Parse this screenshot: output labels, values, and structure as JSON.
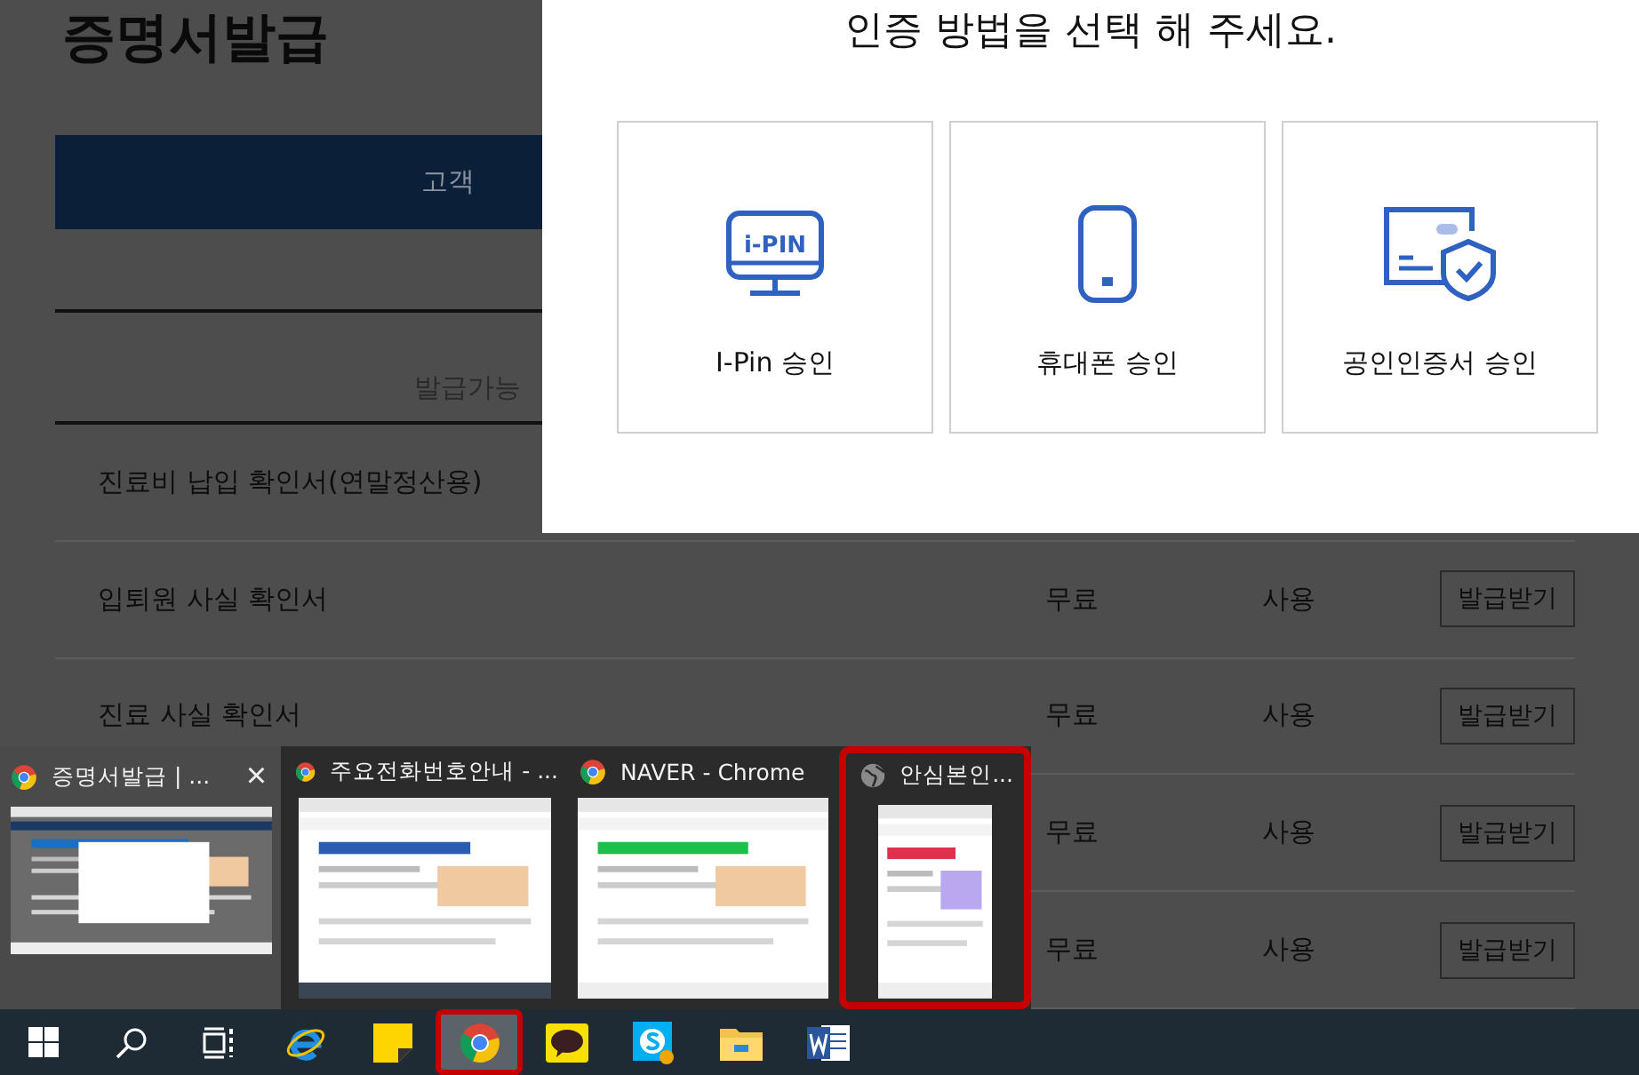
{
  "page": {
    "heading": "증명서발급",
    "tab": "고객",
    "column_header": "발급가능",
    "rows": [
      {
        "name": "진료비 납입 확인서(연말정산용)"
      },
      {
        "name": "입퇴원 사실 확인서",
        "fee": "무료",
        "use": "사용",
        "button": "발급받기"
      },
      {
        "name": "진료 사실 확인서",
        "fee": "무료",
        "use": "사용",
        "button": "발급받기"
      },
      {
        "fee": "무료",
        "use": "사용",
        "button": "발급받기"
      },
      {
        "fee": "무료",
        "use": "사용",
        "button": "발급받기"
      }
    ]
  },
  "modal": {
    "title": "인증 방법을 선택 해 주세요.",
    "options": [
      {
        "kind": "ipin",
        "icon_text": "i-PIN",
        "label": "I-Pin 승인"
      },
      {
        "kind": "phone",
        "label": "휴대폰 승인"
      },
      {
        "kind": "certificate",
        "label": "공인인증서 승인"
      }
    ]
  },
  "thumbnails": [
    {
      "title": "증명서발급 | ...",
      "hovered": true,
      "highlighted": false,
      "kind": "chrome",
      "close": "×"
    },
    {
      "title": "주요전화번호안내 - ...",
      "hovered": false,
      "highlighted": false,
      "kind": "chrome"
    },
    {
      "title": "NAVER - Chrome",
      "hovered": false,
      "highlighted": false,
      "kind": "chrome"
    },
    {
      "title": "안심본인...",
      "hovered": false,
      "highlighted": true,
      "kind": "globe"
    }
  ],
  "taskbar": [
    {
      "kind": "start",
      "active": false,
      "highlighted": false
    },
    {
      "kind": "search",
      "active": false,
      "highlighted": false
    },
    {
      "kind": "taskview",
      "active": false,
      "highlighted": false
    },
    {
      "kind": "ie",
      "active": false,
      "highlighted": false
    },
    {
      "kind": "notes",
      "active": false,
      "highlighted": false
    },
    {
      "kind": "chrome",
      "active": true,
      "highlighted": true
    },
    {
      "kind": "talk",
      "active": false,
      "highlighted": false
    },
    {
      "kind": "skype",
      "active": false,
      "highlighted": false
    },
    {
      "kind": "folder",
      "active": false,
      "highlighted": false
    },
    {
      "kind": "word",
      "active": false,
      "highlighted": false
    }
  ]
}
